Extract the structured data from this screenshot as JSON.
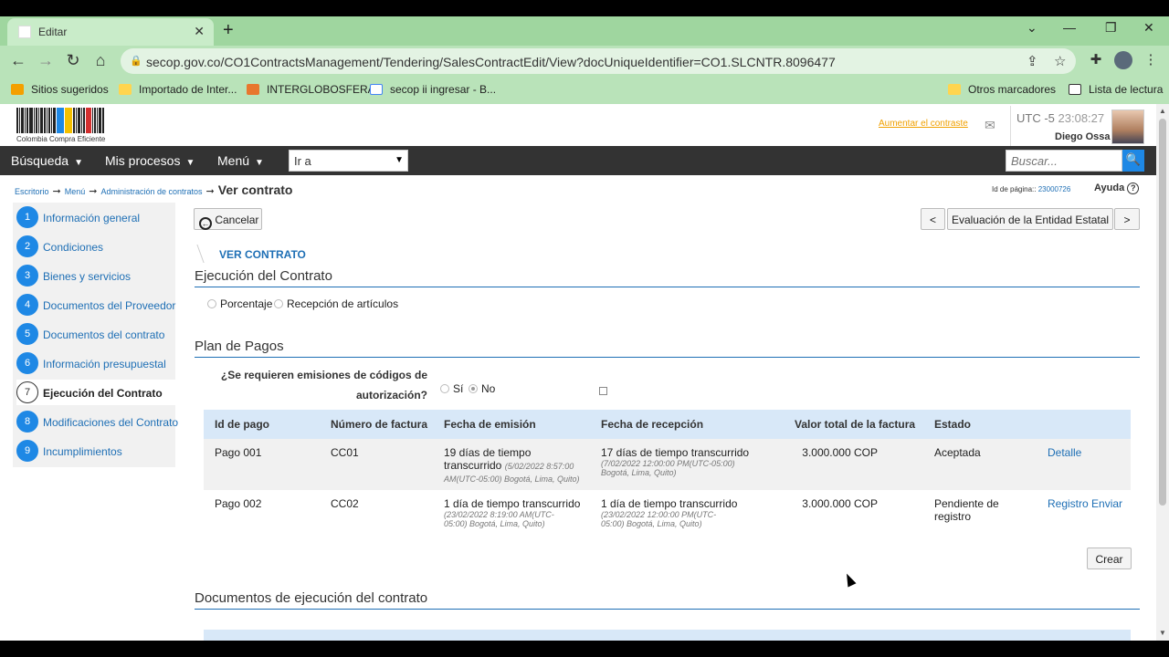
{
  "browser": {
    "tab_title": "Editar",
    "tab_close": "✕",
    "new_tab": "+",
    "url": "secop.gov.co/CO1ContractsManagement/Tendering/SalesContractEdit/View?docUniqueIdentifier=CO1.SLCNTR.8096477",
    "bookmarks": [
      "Sitios sugeridos",
      "Importado de Inter...",
      "INTERGLOBOSFERA",
      "secop ii ingresar - B...",
      "Otros marcadores",
      "Lista de lectura"
    ]
  },
  "header": {
    "logo_caption": "Colombia Compra Eficiente",
    "contrast_link": "Aumentar el contraste",
    "timezone": "UTC -5",
    "time": "23:08:27",
    "user_name": "Diego Ossa"
  },
  "nav": {
    "busqueda": "Búsqueda",
    "mis_procesos": "Mis procesos",
    "menu": "Menú",
    "ir_a": "Ir a",
    "search_placeholder": "Buscar..."
  },
  "breadcrumb": {
    "items": [
      "Escritorio",
      "Menú",
      "Administración de contratos"
    ],
    "current": "Ver contrato",
    "page_id_label": "Id de página::",
    "page_id": "23000726",
    "help": "Ayuda"
  },
  "sidebar": {
    "steps": [
      {
        "num": "1",
        "label": "Información general"
      },
      {
        "num": "2",
        "label": "Condiciones"
      },
      {
        "num": "3",
        "label": "Bienes y servicios"
      },
      {
        "num": "4",
        "label": "Documentos del Proveedor"
      },
      {
        "num": "5",
        "label": "Documentos del contrato"
      },
      {
        "num": "6",
        "label": "Información presupuestal"
      },
      {
        "num": "7",
        "label": "Ejecución del Contrato"
      },
      {
        "num": "8",
        "label": "Modificaciones del Contrato"
      },
      {
        "num": "9",
        "label": "Incumplimientos"
      }
    ]
  },
  "main": {
    "cancel": "Cancelar",
    "prev": "<",
    "next": ">",
    "eval_button": "Evaluación de la Entidad Estatal",
    "ver_contrato": "VER CONTRATO",
    "section_ejecucion": "Ejecución del Contrato",
    "opt_porcentaje": "Porcentaje",
    "opt_recepcion": "Recepción de artículos",
    "section_plan": "Plan de Pagos",
    "question_line1": "¿Se requieren emisiones de códigos de",
    "question_line2": "autorización?",
    "opt_si": "Sí",
    "opt_no": "No",
    "table": {
      "headers": [
        "Id de pago",
        "Número de factura",
        "Fecha de emisión",
        "Fecha de recepción",
        "Valor total de la factura",
        "Estado"
      ],
      "rows": [
        {
          "id": "Pago 001",
          "factura": "CC01",
          "emision": "19 días de tiempo transcurrido",
          "emision_sub": "(5/02/2022 8:57:00 AM(UTC-05:00) Bogotá, Lima, Quito)",
          "recepcion": "17 días de tiempo transcurrido",
          "recepcion_sub": "(7/02/2022 12:00:00 PM(UTC-05:00) Bogotá, Lima, Quito)",
          "valor": "3.000.000 COP",
          "estado": "Aceptada",
          "action1": "Detalle",
          "action2": ""
        },
        {
          "id": "Pago 002",
          "factura": "CC02",
          "emision": "1 día de tiempo transcurrido",
          "emision_sub": "(23/02/2022 8:19:00 AM(UTC-05:00) Bogotá, Lima, Quito)",
          "recepcion": "1 día de tiempo transcurrido",
          "recepcion_sub": "(23/02/2022 12:00:00 PM(UTC-05:00) Bogotá, Lima, Quito)",
          "valor": "3.000.000 COP",
          "estado": "Pendiente de registro",
          "action1": "Registro",
          "action2": "Enviar"
        }
      ]
    },
    "create": "Crear",
    "section_docs": "Documentos de ejecución del contrato"
  },
  "colors": {
    "accent": "#1e88e5",
    "link": "#1e6fb5",
    "navbar": "#333333",
    "chrome": "#b9e3b9"
  }
}
